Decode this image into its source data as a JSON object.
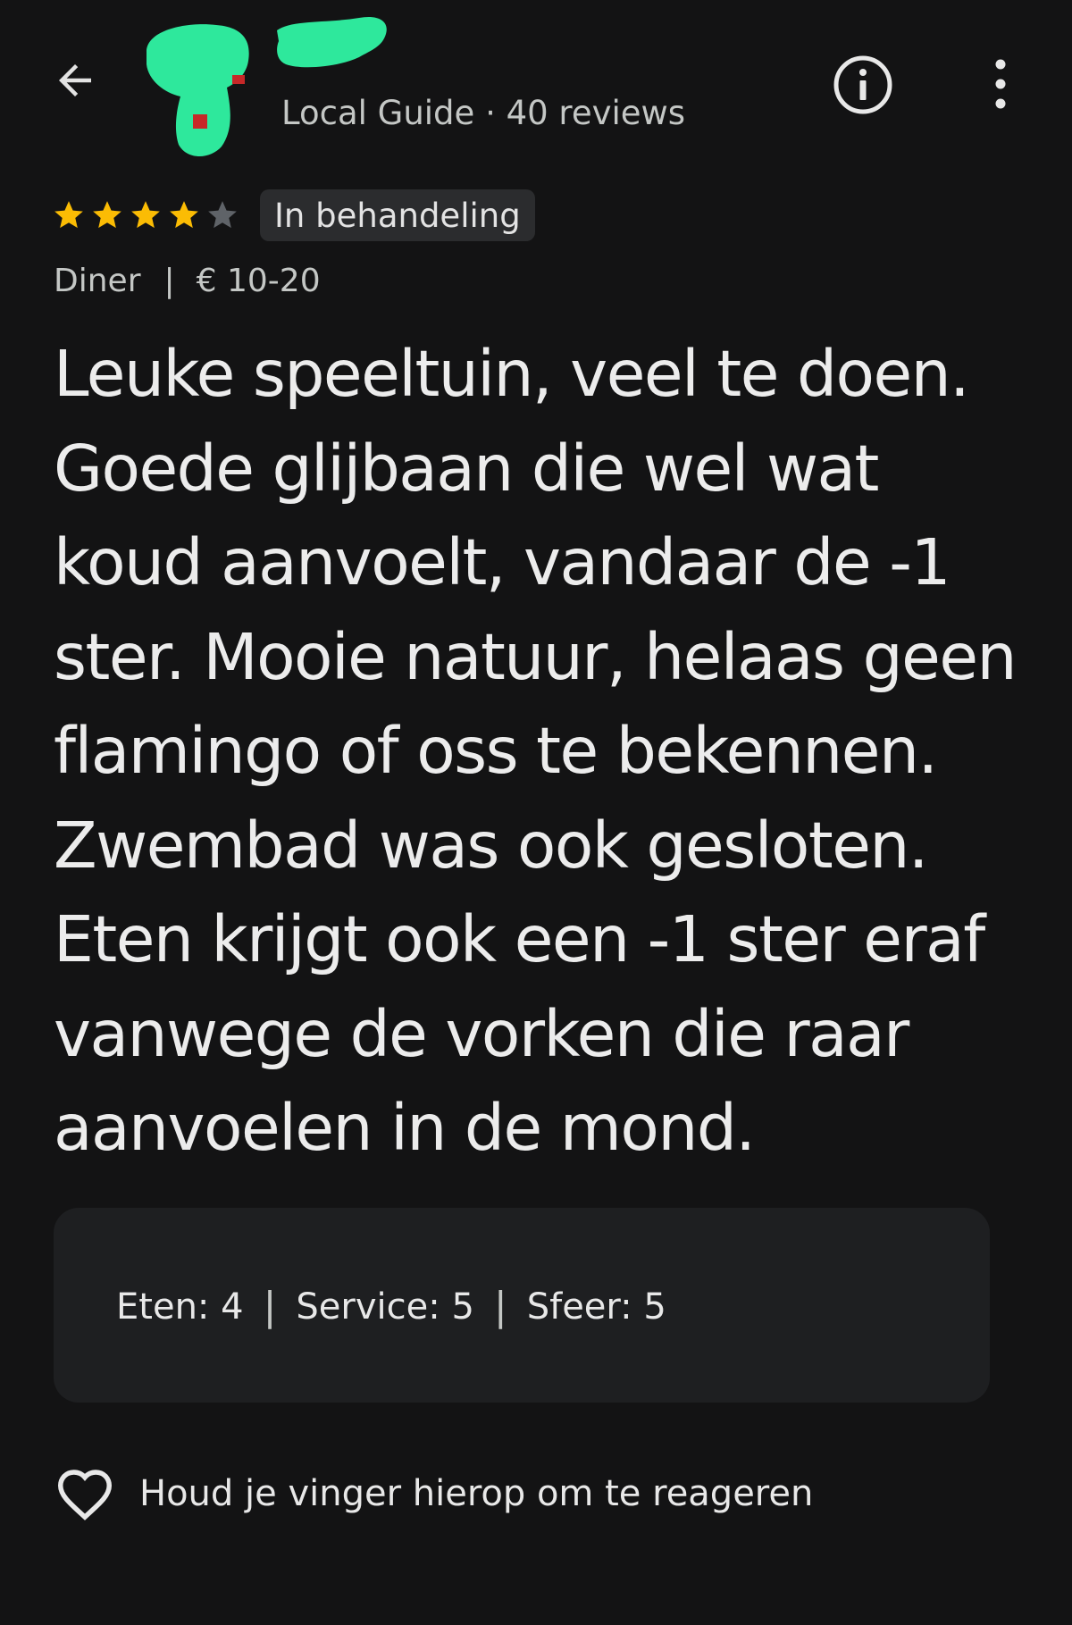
{
  "header": {
    "subtitle": "Local Guide · 40 reviews",
    "icons": {
      "back": "arrow-back-icon",
      "info": "info-icon",
      "more": "more-vert-icon"
    },
    "redaction_color": "#2ee89c"
  },
  "review": {
    "rating": 4,
    "max_rating": 5,
    "star_color": "#fbbc04",
    "star_empty_color": "#5f6368",
    "status_badge": "In behandeling",
    "meal": "Diner",
    "meta_separator": "|",
    "price": "€ 10-20",
    "text_lines": [
      "Leuke speeltuin, veel te doen.",
      "Goede glijbaan die wel wat",
      "koud aanvoelt, vandaar de -1",
      "ster. Mooie natuur, helaas geen",
      "flamingo of oss te bekennen.",
      "Zwembad was ook gesloten.",
      "Eten krijgt ook een -1 ster eraf",
      "vanwege de vorken die raar",
      "aanvoelen in de mond."
    ]
  },
  "sub_ratings": {
    "separator": "|",
    "items": [
      {
        "label": "Eten:",
        "value": "4"
      },
      {
        "label": "Service:",
        "value": "5"
      },
      {
        "label": "Sfeer:",
        "value": "5"
      }
    ]
  },
  "reaction": {
    "icon": "heart-outline-icon",
    "label": "Houd je vinger hierop om te reageren"
  },
  "colors": {
    "background": "#131314",
    "card": "#1e1f21",
    "badge": "#2b2c2e"
  }
}
